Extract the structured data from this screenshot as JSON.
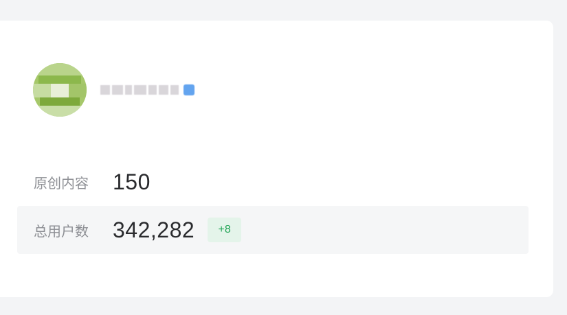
{
  "profile": {
    "avatar_icon": "user-avatar-icon",
    "name": "",
    "verified_icon": "verified-badge-icon"
  },
  "stats": {
    "original_content": {
      "label": "原创内容",
      "value": "150"
    },
    "total_users": {
      "label": "总用户数",
      "value": "342,282",
      "delta": "+8"
    }
  },
  "colors": {
    "page_background": "#f3f4f6",
    "card_background": "#ffffff",
    "highlight_row": "#f5f6f7",
    "delta_background": "#e4f4ea",
    "delta_text": "#22a556",
    "label_text": "#8d8f94",
    "value_text": "#2a2b2e",
    "verified_badge": "#63a4ef"
  }
}
